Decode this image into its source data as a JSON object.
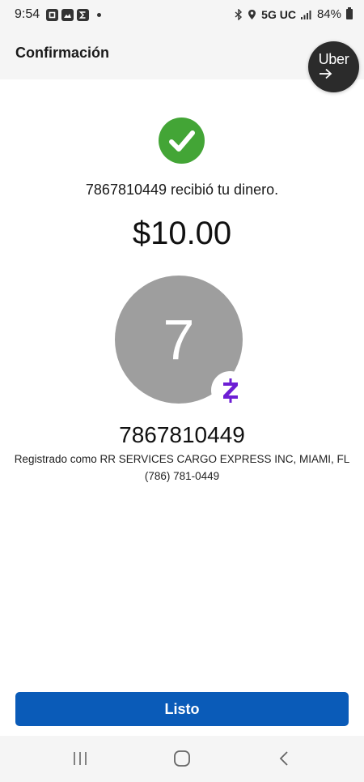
{
  "status_bar": {
    "time": "9:54",
    "network": "5G UC",
    "battery": "84%",
    "icons": [
      "chase-icon",
      "gallery-icon",
      "sigma-icon",
      "notification-dot-icon",
      "bluetooth-icon",
      "location-icon",
      "signal-icon",
      "battery-icon"
    ]
  },
  "header": {
    "title": "Confirmación"
  },
  "uber_bubble": {
    "label": "Uber"
  },
  "confirmation": {
    "received_text": "7867810449 recibió tu dinero.",
    "amount": "$10.00",
    "avatar_initial": "7",
    "recipient": "7867810449",
    "registered_as": "Registrado como RR SERVICES CARGO EXPRESS INC, MIAMI, FL",
    "phone": "(786) 781-0449"
  },
  "done_button": {
    "label": "Listo"
  },
  "colors": {
    "accent_blue": "#0a5bb8",
    "success_green": "#43a536",
    "zelle_purple": "#6d1ed4",
    "avatar_gray": "#9e9e9e"
  }
}
